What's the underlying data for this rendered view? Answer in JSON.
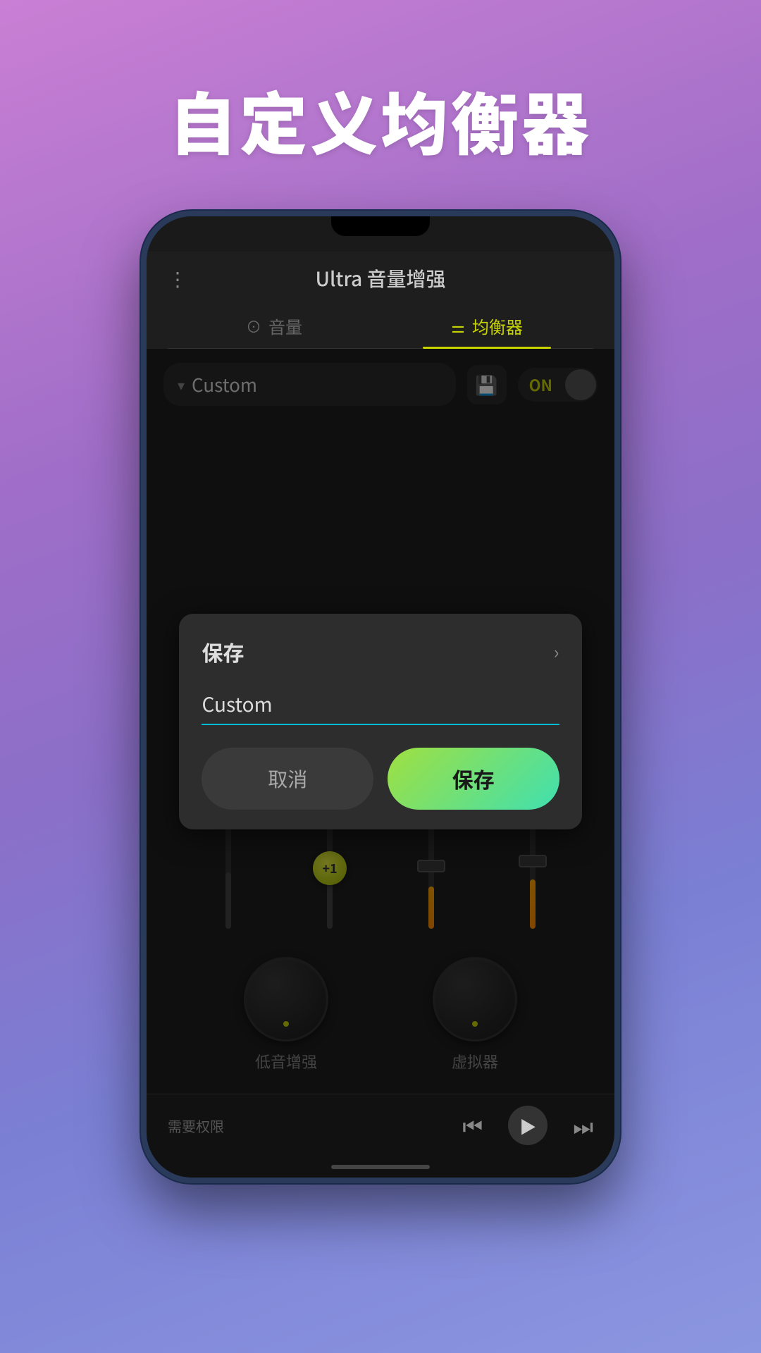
{
  "page": {
    "title": "自定义均衡器",
    "background_gradient": "linear-gradient(160deg, #c97fd4 0%, #a06ec8 30%, #8b6fc8 50%, #7b7fd4 70%, #8b96e0 100%)"
  },
  "app": {
    "header_title": "Ultra 音量增强",
    "tabs": [
      {
        "id": "volume",
        "label": "音量",
        "icon": "⊙",
        "active": false
      },
      {
        "id": "equalizer",
        "label": "均衡器",
        "icon": "🎛",
        "active": true
      }
    ],
    "preset": {
      "name": "Custom",
      "dropdown_arrow": "▾"
    },
    "toggle": {
      "label": "ON",
      "state": "on"
    },
    "eq_bands": [
      {
        "id": "band1",
        "value": -5,
        "type": "dark",
        "fill_height": 80
      },
      {
        "id": "band2",
        "value": 1,
        "type": "green",
        "label": "+1",
        "fill_height": 90
      },
      {
        "id": "band3",
        "value": 0,
        "type": "orange",
        "fill_height": 60
      },
      {
        "id": "band4",
        "value": 2,
        "type": "orange",
        "fill_height": 70
      }
    ],
    "knobs": [
      {
        "id": "bass-boost",
        "label": "低音增强"
      },
      {
        "id": "virtualizer",
        "label": "虚拟器"
      }
    ],
    "player": {
      "permission_text": "需要权限",
      "prev_icon": "⏮",
      "play_icon": "▶",
      "next_icon": "⏭"
    }
  },
  "dialog": {
    "title": "保存",
    "close_icon": "›",
    "input_value": "Custom",
    "input_placeholder": "Custom",
    "cancel_label": "取消",
    "save_label": "保存"
  }
}
